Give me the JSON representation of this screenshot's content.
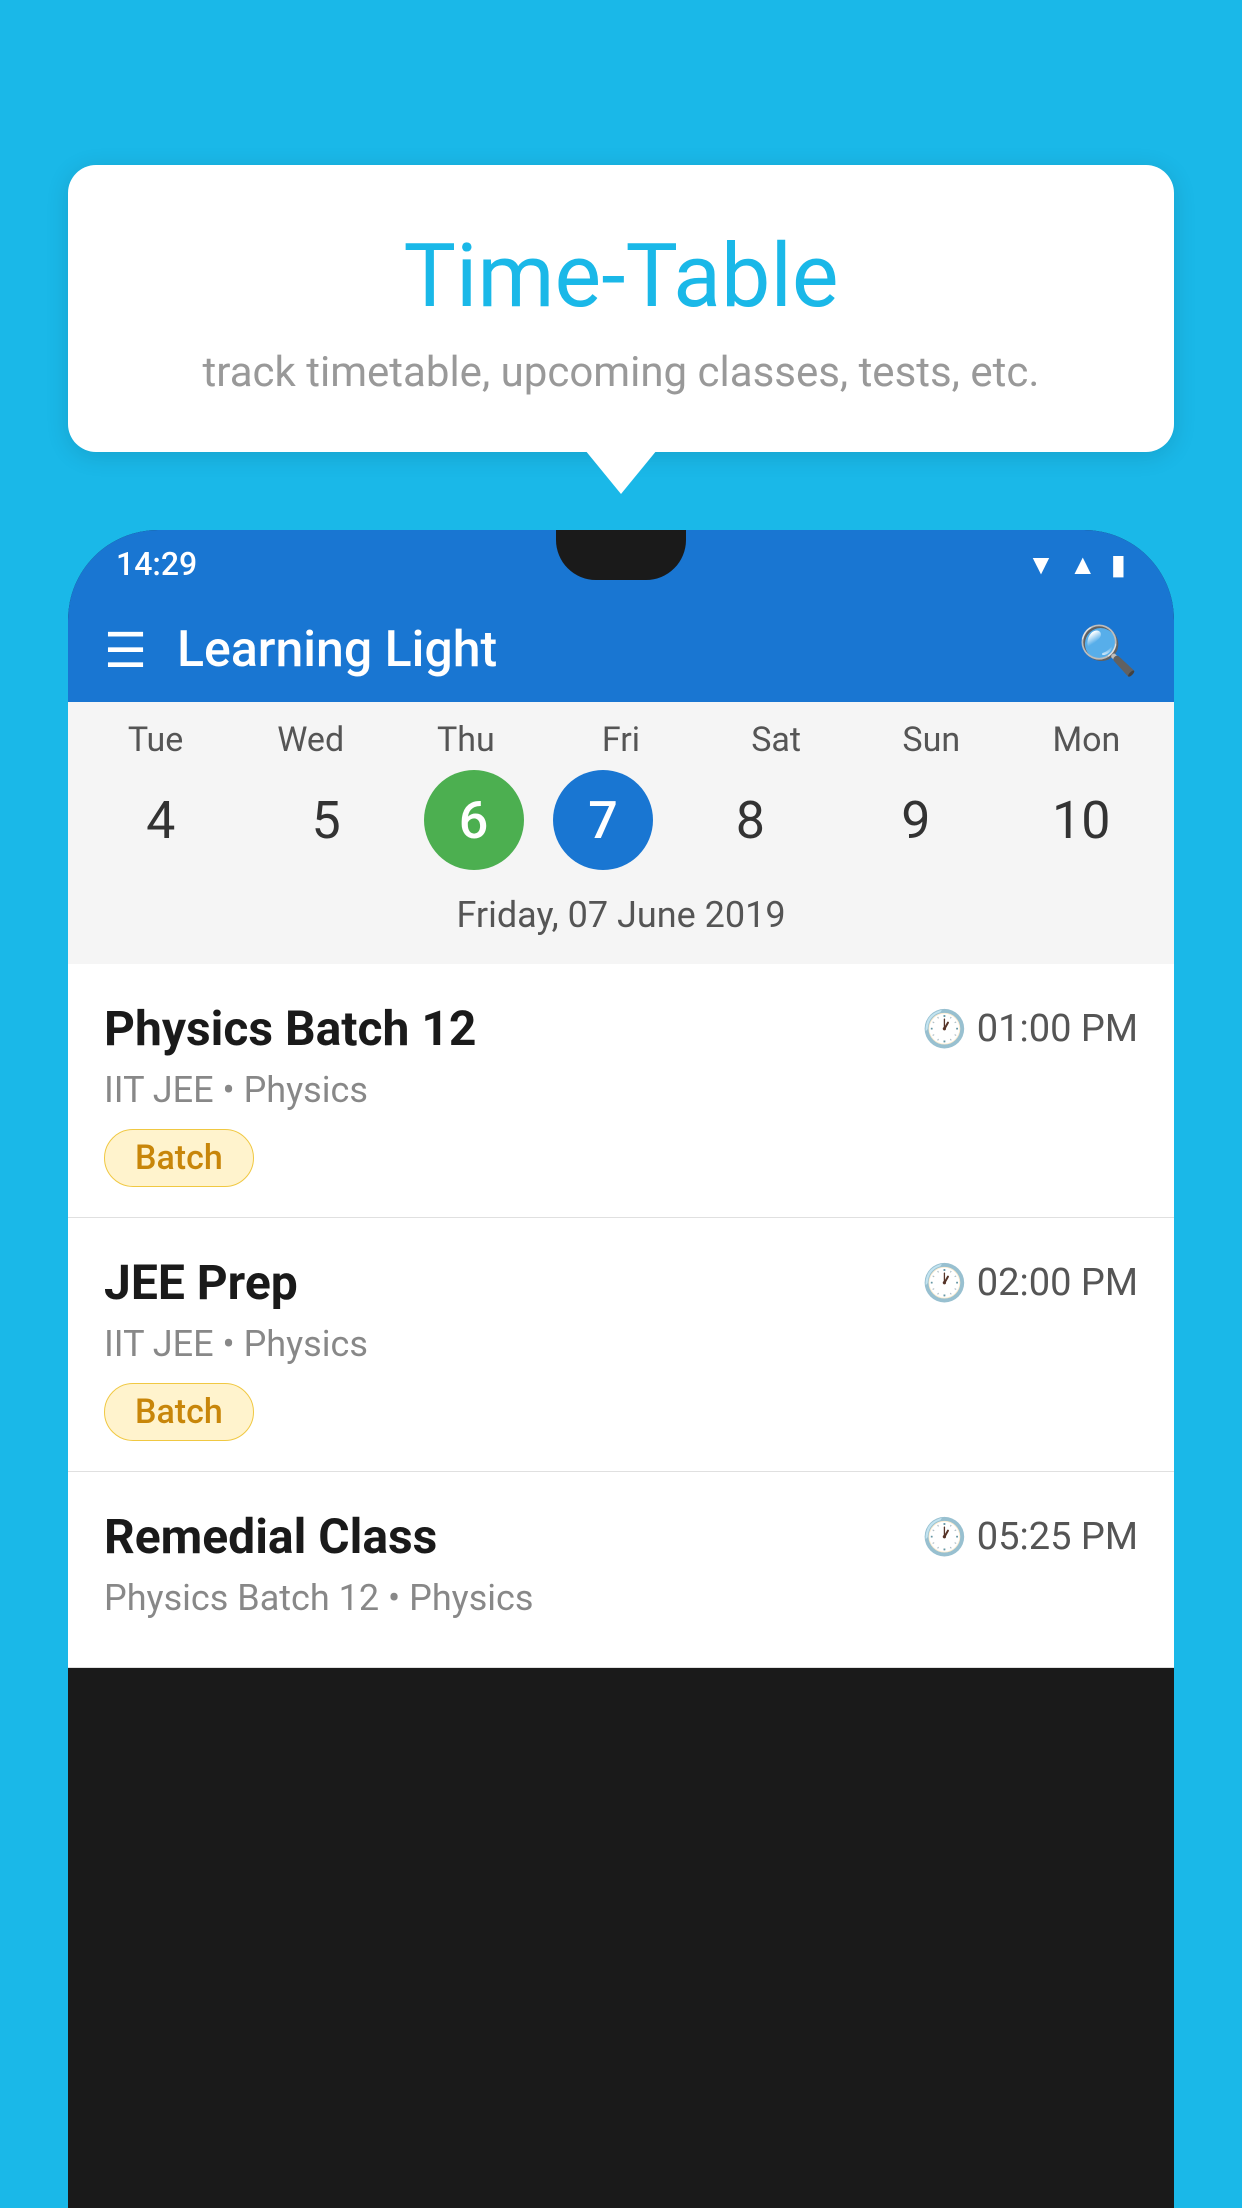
{
  "background_color": "#1ab8e8",
  "tooltip": {
    "title": "Time-Table",
    "subtitle": "track timetable, upcoming classes, tests, etc."
  },
  "phone": {
    "status_bar": {
      "time": "14:29"
    },
    "app_header": {
      "title": "Learning Light"
    },
    "calendar": {
      "days": [
        {
          "name": "Tue",
          "number": "4",
          "state": "normal"
        },
        {
          "name": "Wed",
          "number": "5",
          "state": "normal"
        },
        {
          "name": "Thu",
          "number": "6",
          "state": "today"
        },
        {
          "name": "Fri",
          "number": "7",
          "state": "selected"
        },
        {
          "name": "Sat",
          "number": "8",
          "state": "normal"
        },
        {
          "name": "Sun",
          "number": "9",
          "state": "normal"
        },
        {
          "name": "Mon",
          "number": "10",
          "state": "normal"
        }
      ],
      "selected_date_label": "Friday, 07 June 2019"
    },
    "schedule": [
      {
        "name": "Physics Batch 12",
        "time": "01:00 PM",
        "meta": "IIT JEE • Physics",
        "badge": "Batch"
      },
      {
        "name": "JEE Prep",
        "time": "02:00 PM",
        "meta": "IIT JEE • Physics",
        "badge": "Batch"
      },
      {
        "name": "Remedial Class",
        "time": "05:25 PM",
        "meta": "Physics Batch 12 • Physics",
        "badge": null
      }
    ]
  },
  "icons": {
    "menu": "☰",
    "search": "🔍",
    "clock": "🕐",
    "wifi": "▲",
    "signal": "▲",
    "battery": "▮"
  }
}
